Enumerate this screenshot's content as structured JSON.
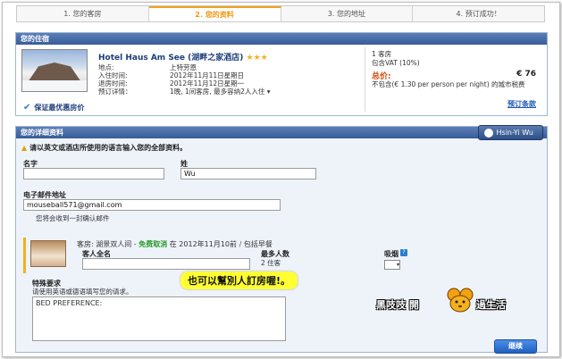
{
  "steps": [
    {
      "label": "1. 您的客房",
      "active": false
    },
    {
      "label": "2. 您的资料",
      "active": true
    },
    {
      "label": "3. 您的地址",
      "active": false
    },
    {
      "label": "4. 预订成功！",
      "active": false
    }
  ],
  "stay": {
    "header": "您的住宿",
    "hotel_name": "Hotel Haus Am See (湖畔之家酒店)",
    "stars": "★★★",
    "rows": [
      {
        "label": "地点:",
        "value": "上特劳恩"
      },
      {
        "label": "入住时间:",
        "value": "2012年11月11日星期日"
      },
      {
        "label": "退房时间:",
        "value": "2012年11月12日星期一"
      },
      {
        "label": "预订详情：",
        "value": "1晚, 1间客房, 最多容纳2人入住"
      }
    ],
    "dropdown_marker": "▾",
    "guarantee": "保证最优惠房价",
    "room_count": "1 客房",
    "vat": "包含VAT (10%)",
    "total_label": "总价:",
    "total_value": "€ 76",
    "tax_note": "不包含(€ 1.30 per person per night) 的城市税费",
    "terms_link": "预订条款"
  },
  "details": {
    "header": "您的详细资料",
    "user_button": "Hsin-Yi Wu",
    "warning": "请以英文或酒店所使用的语言输入您的全部资料。",
    "first_name_label": "名字",
    "first_name_value": "",
    "last_name_label": "姓",
    "last_name_value": "Wu",
    "email_label": "电子邮件地址",
    "email_value": "mouseball571@gmail.com",
    "email_note": "您将会收到一封确认邮件",
    "room": {
      "type": "客房: 湖景双人间 -",
      "free_cancel": "免费取消",
      "deadline": "在 2012年11月10前",
      "slash": "/",
      "breakfast": "包括早餐",
      "guest_label": "客人全名",
      "guest_value": "",
      "max_label": "最多人数",
      "max_value": "2 住客",
      "smoking_label": "吸烟",
      "smoking_select": "▾",
      "help": "?"
    },
    "special_label": "特殊要求",
    "special_hint": "请使用英语或德语填写您的请求。",
    "special_value": "BED PREFERENCE:",
    "continue": "继续"
  },
  "annotation": "也可以幫別人訂房喔!。",
  "watermark": {
    "left": "黑吱吱 開",
    "right": "過生活"
  },
  "colors": {
    "accent": "#f09a12",
    "header_blue": "#375c98",
    "link_blue": "#1f5ab8",
    "total_orange": "#d44a10"
  }
}
